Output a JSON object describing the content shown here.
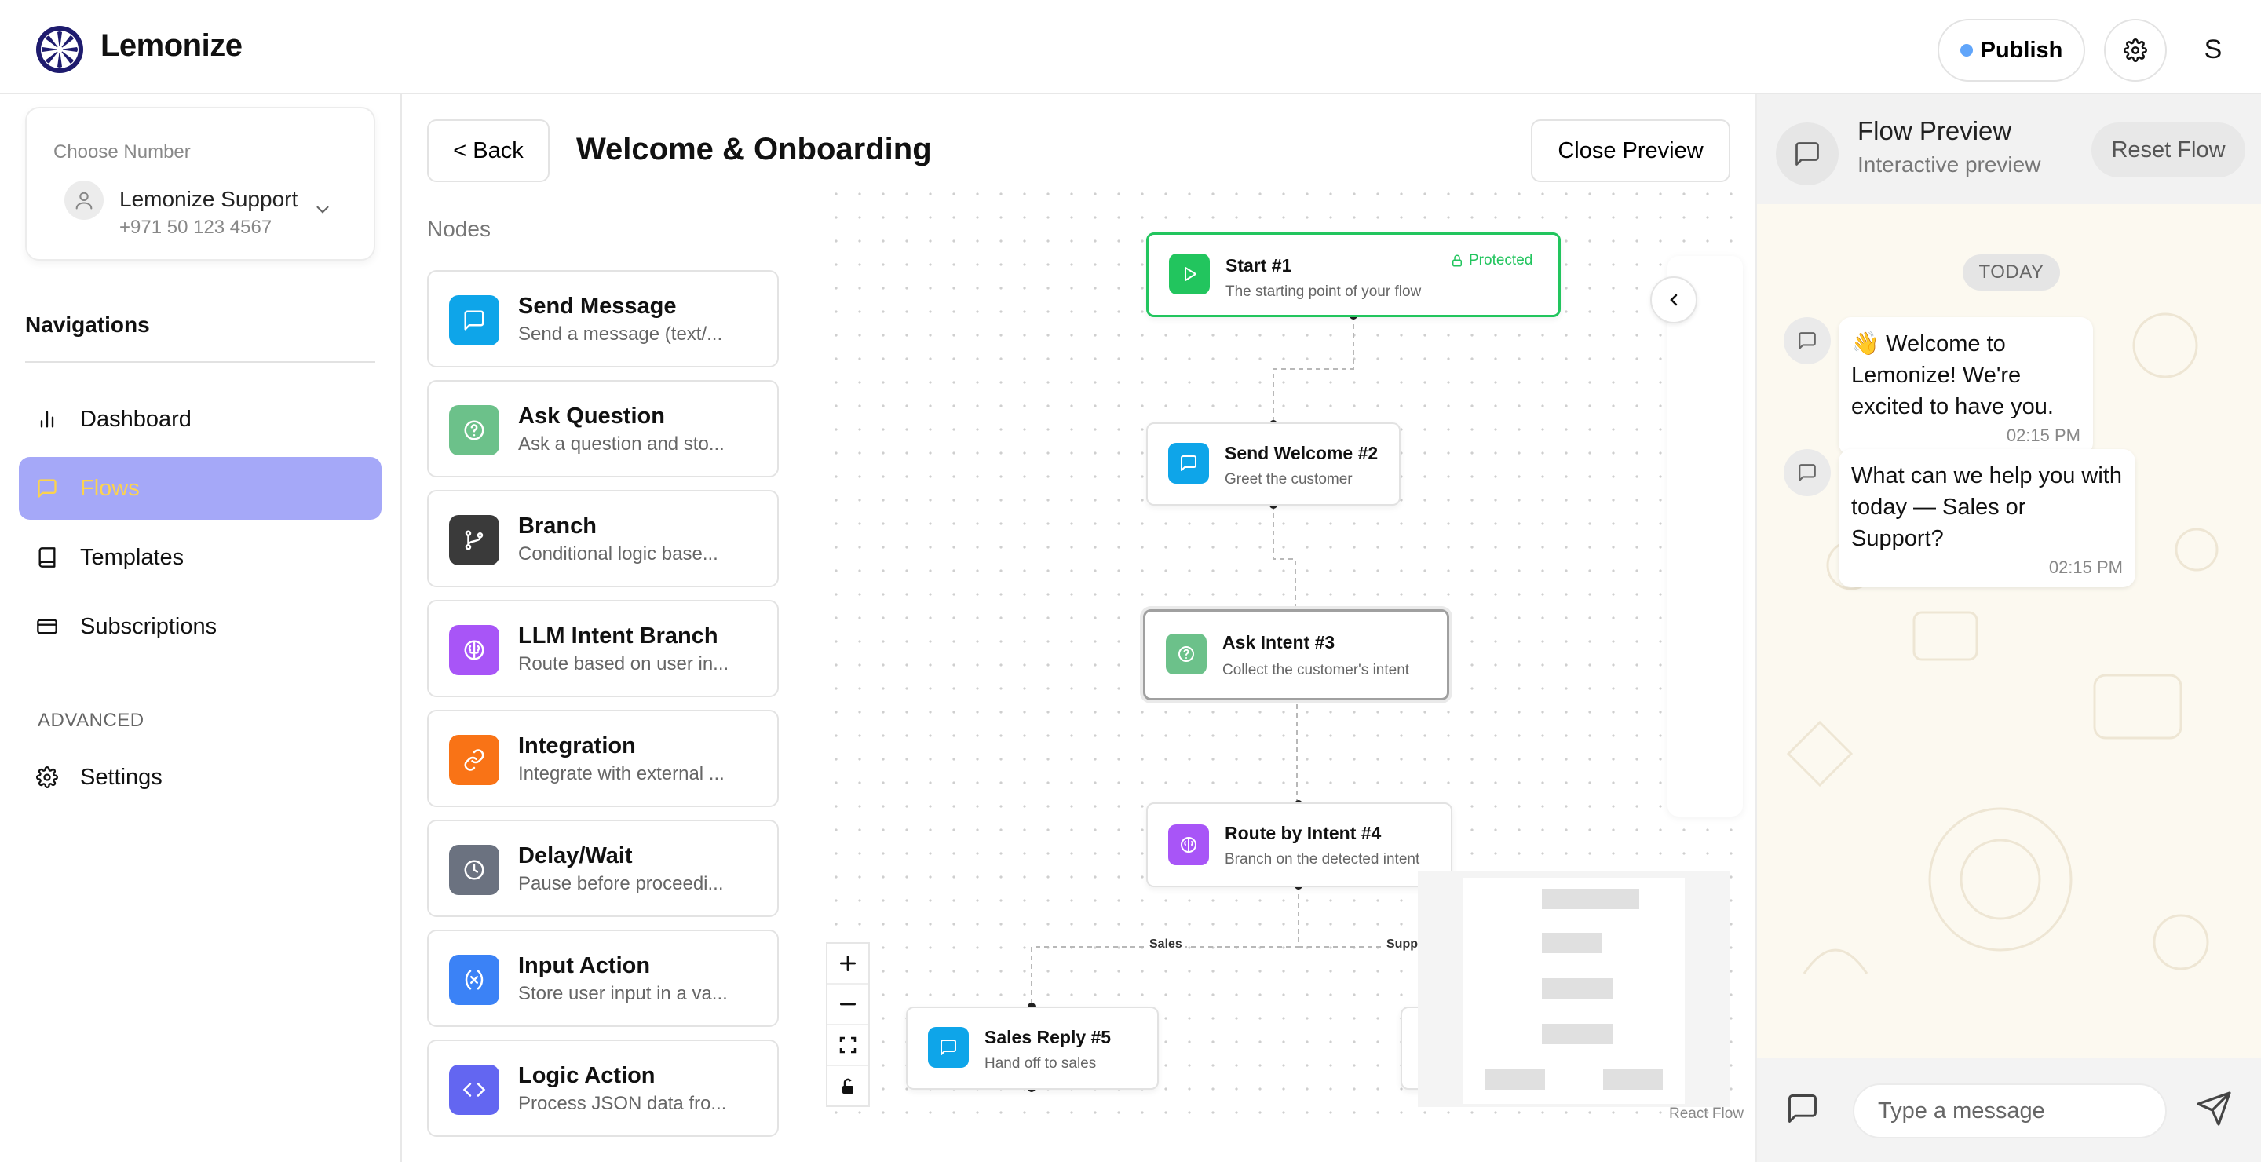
{
  "app": {
    "brand_name": "Lemonize"
  },
  "header": {
    "publish_label": "Publish",
    "user_initial": "S"
  },
  "sidebar": {
    "choose_number_label": "Choose Number",
    "account_name": "Lemonize Support",
    "account_phone": "+971 50 123 4567",
    "nav_heading": "Navigations",
    "items": [
      {
        "label": "Dashboard",
        "icon": "bar-chart-icon",
        "active": false
      },
      {
        "label": "Flows",
        "icon": "message-icon",
        "active": true
      },
      {
        "label": "Templates",
        "icon": "book-icon",
        "active": false
      },
      {
        "label": "Subscriptions",
        "icon": "credit-card-icon",
        "active": false
      }
    ],
    "advanced_heading": "ADVANCED",
    "settings_label": "Settings"
  },
  "editor": {
    "back_label": "< Back",
    "flow_title": "Welcome & Onboarding",
    "close_preview_label": "Close Preview",
    "nodes_heading": "Nodes",
    "palette": [
      {
        "title": "Send Message",
        "desc": "Send a message (text/...",
        "icon": "message-icon",
        "color": "#0ea5e9"
      },
      {
        "title": "Ask Question",
        "desc": "Ask a question and sto...",
        "icon": "question-icon",
        "color": "#6cc18a"
      },
      {
        "title": "Branch",
        "desc": "Conditional logic base...",
        "icon": "git-branch-icon",
        "color": "#3a3a3a"
      },
      {
        "title": "LLM Intent Branch",
        "desc": "Route based on user in...",
        "icon": "brain-icon",
        "color": "#a855f7"
      },
      {
        "title": "Integration",
        "desc": "Integrate with external ...",
        "icon": "link-icon",
        "color": "#f97316"
      },
      {
        "title": "Delay/Wait",
        "desc": "Pause before proceedi...",
        "icon": "clock-icon",
        "color": "#6b7280"
      },
      {
        "title": "Input Action",
        "desc": "Store user input in a va...",
        "icon": "variable-icon",
        "color": "#3b82f6"
      },
      {
        "title": "Logic Action",
        "desc": "Process JSON data fro...",
        "icon": "code-icon",
        "color": "#6366f1"
      }
    ],
    "flow_nodes": {
      "start": {
        "title": "Start #1",
        "desc": "The starting point of your flow",
        "badge": "Protected"
      },
      "welcome": {
        "title": "Send Welcome #2",
        "desc": "Greet the customer"
      },
      "ask": {
        "title": "Ask Intent #3",
        "desc": "Collect the customer's intent"
      },
      "route": {
        "title": "Route by Intent #4",
        "desc": "Branch on the detected intent"
      },
      "sales": {
        "title": "Sales Reply #5",
        "desc": "Hand off to sales"
      }
    },
    "edge_labels": {
      "sales": "Sales",
      "support": "Supp"
    },
    "attribution": "React Flow"
  },
  "preview": {
    "title": "Flow Preview",
    "subtitle": "Interactive preview",
    "reset_label": "Reset Flow",
    "day_label": "TODAY",
    "messages": [
      {
        "text": "👋 Welcome to Lemonize! We're excited to have you.",
        "time": "02:15 PM"
      },
      {
        "text": "What can we help you with today — Sales or Support?",
        "time": "02:15 PM"
      }
    ],
    "input_placeholder": "Type a message"
  },
  "colors": {
    "accent_active": "#a5a8f8",
    "active_text": "#fcd34d",
    "start_border": "#22c55e",
    "brand": "#1e1b6e"
  }
}
